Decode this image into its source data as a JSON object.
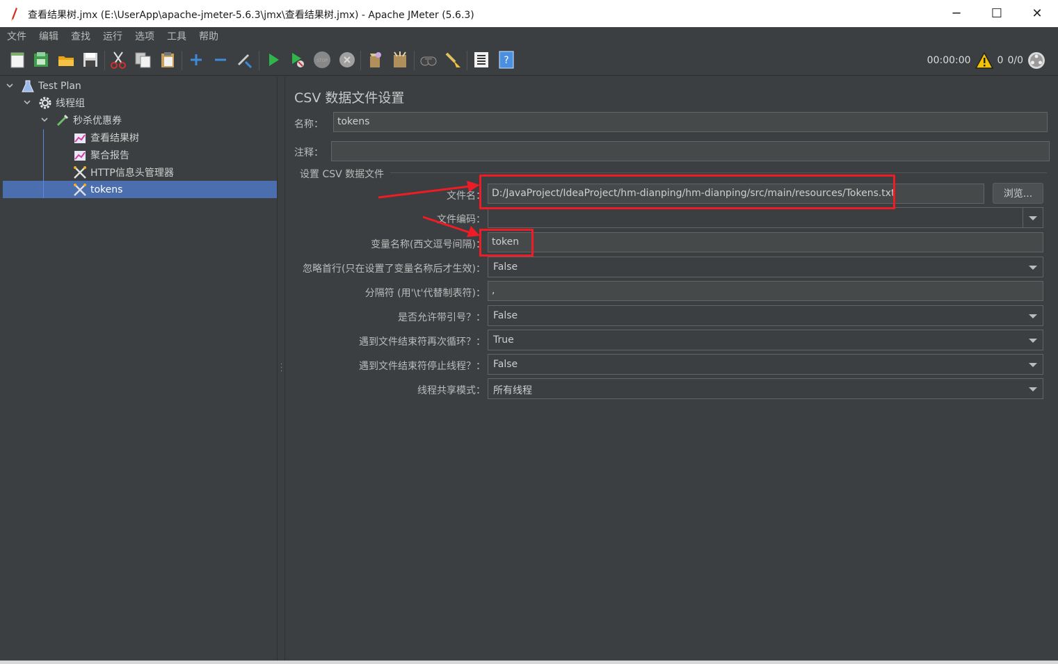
{
  "window": {
    "title": "查看结果树.jmx (E:\\UserApp\\apache-jmeter-5.6.3\\jmx\\查看结果树.jmx) - Apache JMeter (5.6.3)",
    "minimize": "─",
    "maximize": "☐",
    "close": "✕"
  },
  "menu": [
    "文件",
    "编辑",
    "查找",
    "运行",
    "选项",
    "工具",
    "帮助"
  ],
  "toolbar": {
    "icons": [
      "new-icon",
      "templates-icon",
      "open-icon",
      "save-icon",
      "cut-icon",
      "copy-icon",
      "paste-icon",
      "expand-icon",
      "collapse-icon",
      "toggle-icon",
      "start-icon",
      "start-no-timers-icon",
      "stop-icon",
      "shutdown-icon",
      "clear-icon",
      "clear-all-icon",
      "search-icon",
      "reset-search-icon",
      "function-helper-icon",
      "help-icon"
    ],
    "elapsed": "00:00:00",
    "warnings": "0",
    "threads": "0/0"
  },
  "tree": {
    "root": "Test Plan",
    "thread_group": "线程组",
    "sampler": "秒杀优惠券",
    "children": [
      "查看结果树",
      "聚合报告",
      "HTTP信息头管理器",
      "tokens"
    ],
    "selected": "tokens"
  },
  "panel": {
    "title": "CSV 数据文件设置",
    "name_label": "名称：",
    "name_value": "tokens",
    "comment_label": "注释：",
    "comment_value": "",
    "section_title": "设置 CSV 数据文件",
    "filename_label": "文件名：",
    "filename_value": "D:/JavaProject/IdeaProject/hm-dianping/hm-dianping/src/main/resources/Tokens.txt",
    "browse_label": "浏览...",
    "encoding_label": "文件编码：",
    "encoding_value": "",
    "varnames_label": "变量名称(西文逗号间隔)：",
    "varnames_value": "token",
    "ignore_first_label": "忽略首行(只在设置了变量名称后才生效)：",
    "ignore_first_value": "False",
    "delimiter_label": "分隔符 (用'\\t'代替制表符)：",
    "delimiter_value": ",",
    "quoted_label": "是否允许带引号？：",
    "quoted_value": "False",
    "recycle_label": "遇到文件结束符再次循环？：",
    "recycle_value": "True",
    "stop_thread_label": "遇到文件结束符停止线程？：",
    "stop_thread_value": "False",
    "share_mode_label": "线程共享模式：",
    "share_mode_value": "所有线程"
  },
  "colors": {
    "background": "#3c3f41",
    "selection": "#4b6eaf",
    "annotation_red": "#ee1c25"
  }
}
